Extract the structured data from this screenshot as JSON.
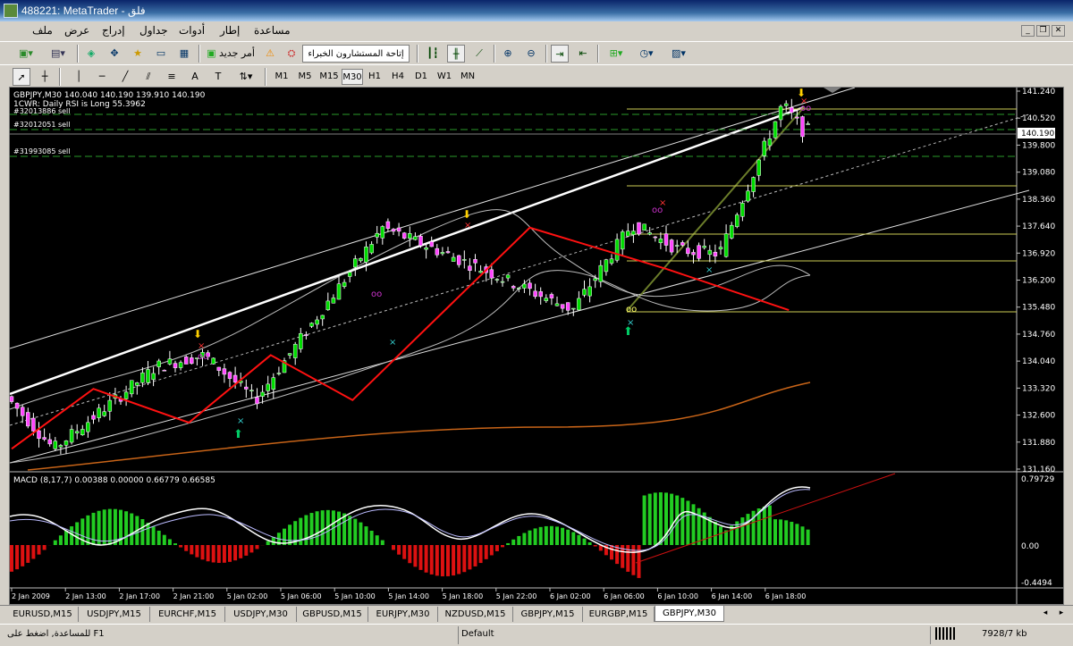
{
  "window": {
    "title": "488221: MetaTrader - فلق"
  },
  "menu": [
    "ملف",
    "عرض",
    "إدراج",
    "جداول",
    "أدوات",
    "إطار",
    "مساعدة"
  ],
  "toolbar": {
    "new_order_label": "أمر جديد",
    "expert_advisors_label": "إتاحة المستشارون الخبراء"
  },
  "timeframes": [
    "M1",
    "M5",
    "M15",
    "M30",
    "H1",
    "H4",
    "D1",
    "W1",
    "MN"
  ],
  "active_timeframe": "M30",
  "chart": {
    "header": "GBPJPY,M30  140.040 140.190 139.910 140.190",
    "indicator_line": "1CWR: Daily RSI is Long 55.3962",
    "order_labels": [
      {
        "text": "#32013886 sell",
        "price": 140.79
      },
      {
        "text": "#32012051 sell",
        "price": 140.4
      },
      {
        "text": "#31993085 sell",
        "price": 139.49
      }
    ],
    "current_price": "140.190",
    "price_ticks": [
      "141.240",
      "140.520",
      "139.800",
      "139.080",
      "138.360",
      "137.640",
      "136.920",
      "136.200",
      "135.480",
      "134.760",
      "134.040",
      "133.320",
      "132.600",
      "131.880",
      "131.160"
    ],
    "time_ticks": [
      "2 Jan 2009",
      "2 Jan 13:00",
      "2 Jan 17:00",
      "2 Jan 21:00",
      "5 Jan 02:00",
      "5 Jan 06:00",
      "5 Jan 10:00",
      "5 Jan 14:00",
      "5 Jan 18:00",
      "5 Jan 22:00",
      "6 Jan 02:00",
      "6 Jan 06:00",
      "6 Jan 10:00",
      "6 Jan 14:00",
      "6 Jan 18:00"
    ],
    "macd_label": "MACD  (8,17,7)  0.00388  0.00000  0.66779  0.66585",
    "macd_ticks": [
      "0.79729",
      "0.00",
      "-0.4494"
    ],
    "zigzag_points": [
      [
        131.7,
        0
      ],
      [
        133.3,
        6
      ],
      [
        132.4,
        13
      ],
      [
        134.2,
        19
      ],
      [
        133.0,
        25
      ],
      [
        137.6,
        38
      ],
      [
        136.5,
        48
      ],
      [
        135.4,
        57
      ]
    ],
    "colors": {
      "bull_bar": "#00dd00",
      "bear_bar": "#ff0000",
      "zigzag": "#ff0000",
      "background": "#000000"
    }
  },
  "symbol_tabs": [
    "EURUSD,M15",
    "USDJPY,M15",
    "EURCHF,M15",
    "USDJPY,M30",
    "GBPUSD,M15",
    "EURJPY,M30",
    "NZDUSD,M15",
    "GBPJPY,M15",
    "EURGBP,M15",
    "GBPJPY,M30"
  ],
  "active_tab": "GBPJPY,M30",
  "status": {
    "help": "للمساعدة, اضغط على F1",
    "profile": "Default",
    "traffic": "7928/7 kb"
  }
}
